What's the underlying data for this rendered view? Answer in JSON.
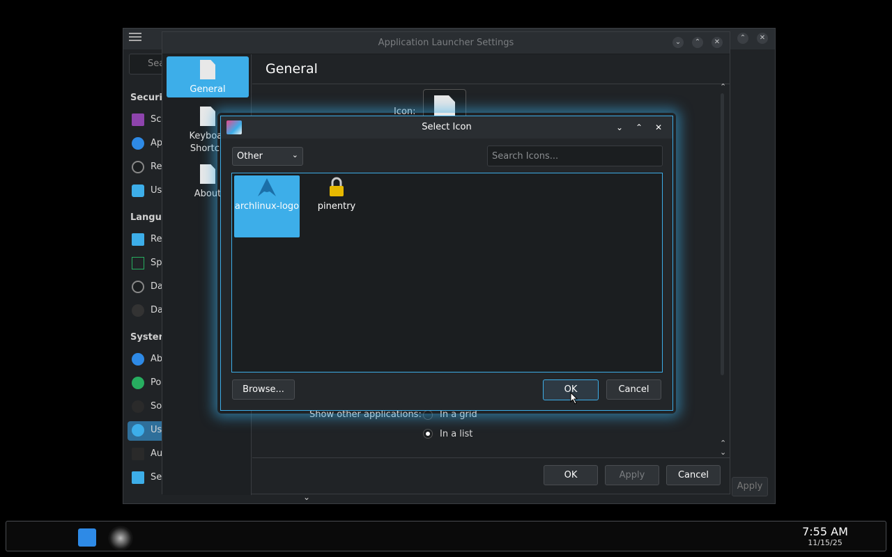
{
  "background_window": {
    "search_placeholder": "Sea",
    "sections": [
      {
        "label": "Securit",
        "items": [
          {
            "label": "Sc",
            "icon": "screen-lock-icon",
            "color": "#8e44ad"
          },
          {
            "label": "Ap",
            "icon": "shield-icon",
            "color": "#2e8ae6"
          },
          {
            "label": "Re",
            "icon": "clock-icon",
            "color": "#888888"
          },
          {
            "label": "Us",
            "icon": "chat-icon",
            "color": "#3daee9"
          }
        ]
      },
      {
        "label": "Langua",
        "items": [
          {
            "label": "Re",
            "icon": "monitor-icon",
            "color": "#3daee9"
          },
          {
            "label": "Sp",
            "icon": "spell-icon",
            "color": "#27ae60"
          },
          {
            "label": "Da",
            "icon": "clock-icon",
            "color": "#888888"
          },
          {
            "label": "Da",
            "icon": "disk-icon",
            "color": "#444444"
          }
        ]
      },
      {
        "label": "System",
        "items": [
          {
            "label": "Ab",
            "icon": "info-icon",
            "color": "#2e8ae6"
          },
          {
            "label": "Po",
            "icon": "power-icon",
            "color": "#27ae60"
          },
          {
            "label": "So",
            "icon": "software-icon",
            "color": "#444444"
          },
          {
            "label": "Us",
            "icon": "users-icon",
            "color": "#3daee9"
          },
          {
            "label": "Au",
            "icon": "autostart-icon",
            "color": "#444444"
          },
          {
            "label": "Se",
            "icon": "keyboard-icon",
            "color": "#3daee9"
          }
        ]
      }
    ],
    "apply_label": "Apply"
  },
  "launcher_settings": {
    "title": "Application Launcher Settings",
    "sidebar": [
      {
        "label": "General"
      },
      {
        "label": "Keyboar\nShortcu"
      },
      {
        "label": "About"
      }
    ],
    "heading": "General",
    "icon_label": "Icon:",
    "show_other_label": "Show other applications:",
    "radio_grid": "In a grid",
    "radio_list": "In a list",
    "ok_label": "OK",
    "apply_label": "Apply",
    "cancel_label": "Cancel"
  },
  "select_icon": {
    "title": "Select Icon",
    "category": "Other",
    "search_placeholder": "Search Icons...",
    "icons": [
      {
        "label": "archlinux-logo",
        "icon": "archlinux-logo-icon",
        "selected": true
      },
      {
        "label": "pinentry",
        "icon": "lock-icon",
        "selected": false
      }
    ],
    "browse_label": "Browse...",
    "ok_label": "OK",
    "cancel_label": "Cancel",
    "accent_color": "#3daee9"
  },
  "taskbar": {
    "time": "7:55 AM",
    "date": "11/15/25"
  }
}
